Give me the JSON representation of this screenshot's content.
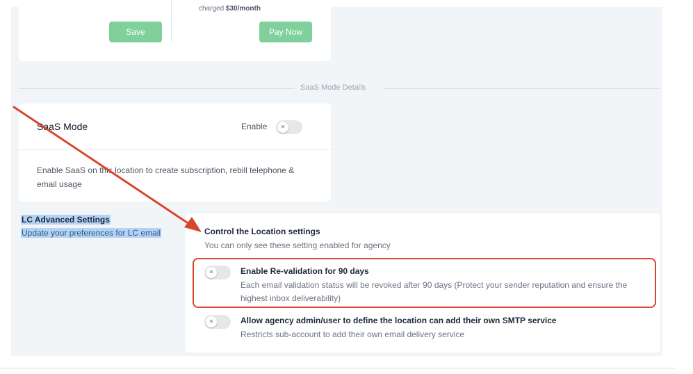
{
  "billing": {
    "charged_prefix": "charged ",
    "charged_amount": "$30/month",
    "save_label": "Save",
    "pay_now_label": "Pay Now"
  },
  "section_divider": {
    "label": "SaaS Mode Details"
  },
  "saas": {
    "title": "SaaS Mode",
    "enable_label": "Enable",
    "enabled": false,
    "description": "Enable SaaS on this location to create subscription, rebill telephone & email usage"
  },
  "lc_advanced": {
    "title": "LC Advanced Settings",
    "subtitle": "Update your preferences for LC email"
  },
  "location_settings": {
    "title": "Control the Location settings",
    "subtitle": "You can only see these setting enabled for agency",
    "options": [
      {
        "title": "Enable Re-validation for 90 days",
        "description": "Each email validation status will be revoked after 90 days (Protect your sender reputation and ensure the highest inbox deliverability)",
        "enabled": false
      },
      {
        "title": "Allow agency admin/user to define the location can add their own SMTP service",
        "description": "Restricts sub-account to add their own email delivery service",
        "enabled": false
      }
    ]
  },
  "colors": {
    "button_green": "#7fd09b",
    "annotation_red": "#d9452f",
    "selection_blue": "#b4d3f4"
  },
  "icons": {
    "toggle_knob": "close-icon"
  }
}
